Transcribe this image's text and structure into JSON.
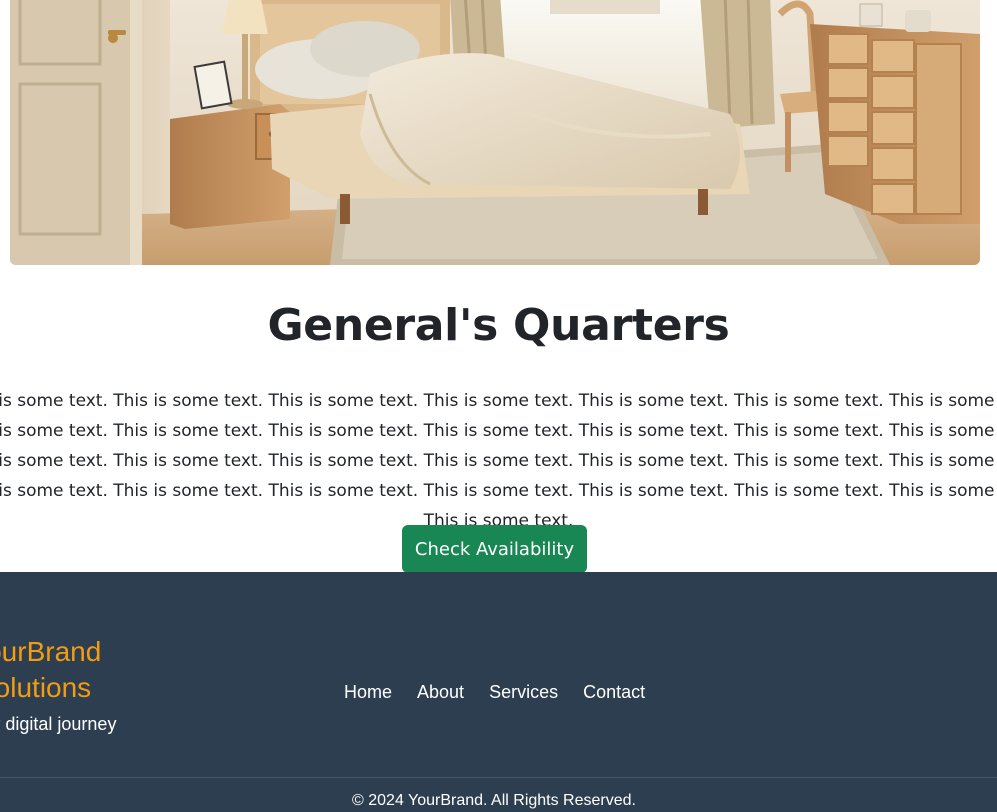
{
  "room": {
    "image_alt": "Bedroom",
    "title": "General's Quarters",
    "description": "This is some text. This is some text. This is some text. This is some text. This is some text. This is some text. This is some text. This is some text. This is some text. This is some text. This is some text. This is some text. This is some text. This is some text. This is some text. This is some text. This is some text. This is some text. This is some text. This is some text. This is some text. This is some text. This is some text. This is some text. This is some text. This is some text. This is some text. This is some text. This is some text.",
    "button_label": "Check Availability"
  },
  "footer": {
    "brand_line_1": "YourBrand",
    "brand_line_2": "Solutions",
    "tagline": "Your digital journey",
    "nav": [
      "Home",
      "About",
      "Services",
      "Contact"
    ],
    "copyright": "© 2024 YourBrand. All Rights Reserved."
  },
  "colors": {
    "button": "#198754",
    "footer_bg": "#2c3e50",
    "brand_accent": "#f39c12"
  }
}
